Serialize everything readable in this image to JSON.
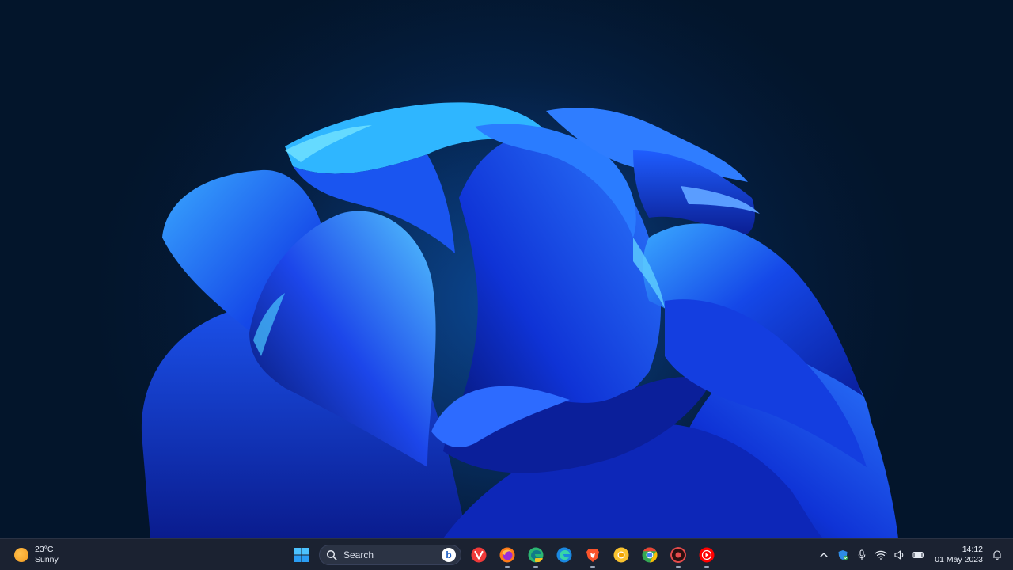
{
  "taskbar": {
    "weather": {
      "temperature": "23°C",
      "condition": "Sunny",
      "icon": "sun-icon"
    },
    "search": {
      "label": "Search",
      "icon": "search-icon"
    },
    "apps": [
      {
        "name": "start-button",
        "icon": "windows-logo-icon"
      },
      {
        "name": "bing-button",
        "icon": "bing-icon"
      },
      {
        "name": "vivaldi-button",
        "icon": "vivaldi-icon"
      },
      {
        "name": "firefox-button",
        "icon": "firefox-icon"
      },
      {
        "name": "edge-canary-button",
        "icon": "edge-canary-icon"
      },
      {
        "name": "edge-button",
        "icon": "edge-icon"
      },
      {
        "name": "brave-button",
        "icon": "brave-icon"
      },
      {
        "name": "chrome-canary-button",
        "icon": "chrome-canary-icon"
      },
      {
        "name": "chrome-button",
        "icon": "chrome-icon"
      },
      {
        "name": "screen-recorder-button",
        "icon": "record-icon"
      },
      {
        "name": "youtube-music-button",
        "icon": "youtube-music-icon"
      }
    ],
    "tray": {
      "icons": [
        "chevron-up-icon",
        "defender-icon",
        "microphone-icon",
        "wifi-icon",
        "volume-icon",
        "battery-icon"
      ],
      "time": "14:12",
      "date": "01 May 2023",
      "notification_icon": "notification-bell-icon"
    }
  },
  "colors": {
    "taskbar_bg": "#1b2231",
    "wallpaper_bloom": "#1f4fff",
    "background": "#031426"
  }
}
